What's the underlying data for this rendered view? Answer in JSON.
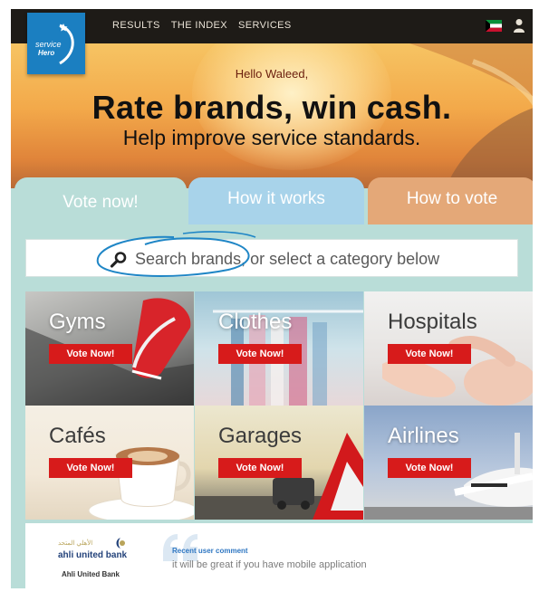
{
  "header": {
    "logo_line1": "service",
    "logo_line2": "Hero",
    "nav": [
      "RESULTS",
      "THE INDEX",
      "SERVICES"
    ],
    "flag_icon": "kuwait-flag-icon",
    "user_icon": "user-icon"
  },
  "hero": {
    "greeting": "Hello Waleed,",
    "headline": "Rate brands, win cash.",
    "subhead": "Help improve service standards."
  },
  "tabs": [
    {
      "label": "Vote now!"
    },
    {
      "label": "How it works"
    },
    {
      "label": "How to vote"
    }
  ],
  "search": {
    "placeholder": "Search brands, or select a category below",
    "icon": "search-icon"
  },
  "categories": [
    {
      "name": "Gyms",
      "button": "Vote Now!"
    },
    {
      "name": "Clothes",
      "button": "Vote Now!"
    },
    {
      "name": "Hospitals",
      "button": "Vote Now!"
    },
    {
      "name": "Cafés",
      "button": "Vote Now!"
    },
    {
      "name": "Garages",
      "button": "Vote Now!"
    },
    {
      "name": "Airlines",
      "button": "Vote Now!"
    }
  ],
  "bottom": {
    "bank_arabic": "الأهلي المتحد",
    "bank_name": "ahli united bank",
    "bank_caption": "Ahli United Bank",
    "recent_label": "Recent user comment",
    "recent_comment": "it will be great if you have mobile application"
  },
  "colors": {
    "nav_bg": "#1e1b17",
    "logo_blue": "#1b7fc1",
    "panel_teal": "#b9ddd8",
    "tab_blue": "#a8d3ea",
    "tab_orange": "#e4a878",
    "vote_red": "#d71b1b",
    "annotation_blue": "#1f86c6"
  }
}
